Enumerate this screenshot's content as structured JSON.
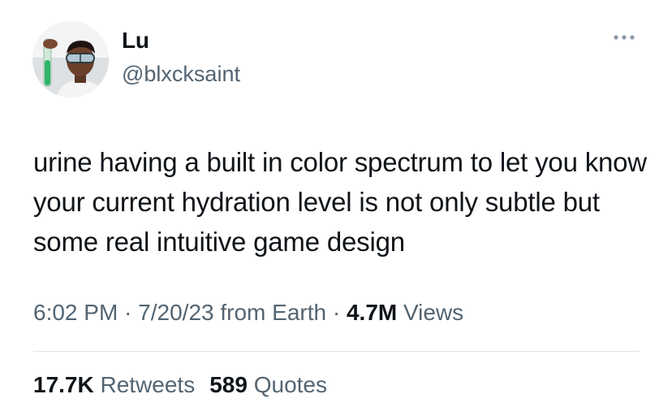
{
  "author": {
    "display_name": "Lu",
    "handle": "@blxcksaint",
    "avatar_icon": "profile-photo"
  },
  "more_icon": "more-horizontal-icon",
  "tweet": {
    "text": "urine having a built in color spectrum to let you know your current hydration level is not only subtle but some real intuitive game design"
  },
  "meta": {
    "time": "6:02 PM",
    "separator1": " · ",
    "date": "7/20/23",
    "source": " from Earth",
    "separator2": " · ",
    "views_count": "4.7M",
    "views_label": " Views"
  },
  "stats": {
    "retweets_count": "17.7K",
    "retweets_label": " Retweets",
    "quotes_count": "589",
    "quotes_label": " Quotes"
  },
  "colors": {
    "text_primary": "#0f1419",
    "text_secondary": "#536471",
    "divider": "#e2e6e9",
    "background": "#ffffff"
  }
}
